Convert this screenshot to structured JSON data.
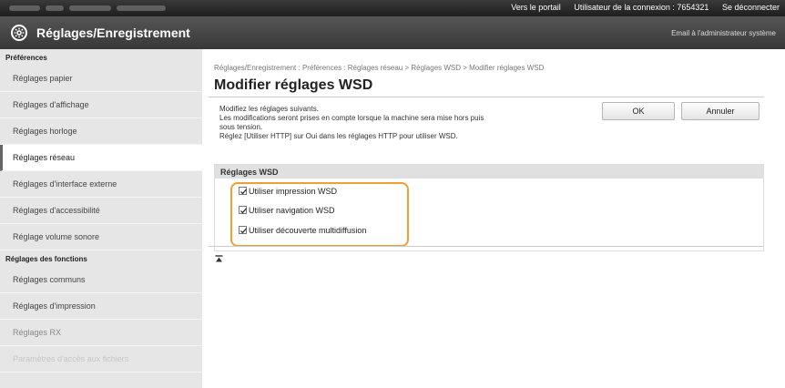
{
  "topbar": {
    "portal_link": "Vers le portail",
    "login_user": "Utilisateur de la connexion : 7654321",
    "logout_link": "Se déconnecter"
  },
  "header": {
    "title": "Réglages/Enregistrement",
    "admin_mail": "Email à l'administrateur système"
  },
  "sidebar": {
    "group_preferences": "Préférences",
    "preferences": [
      "Réglages papier",
      "Réglages d'affichage",
      "Réglages horloge",
      "Réglages réseau",
      "Réglages d'interface externe",
      "Réglages d'accessibilité",
      "Réglage volume sonore"
    ],
    "group_functions": "Réglages des fonctions",
    "functions": [
      "Réglages communs",
      "Réglages d'impression",
      "Réglages RX",
      "Paramètres d'accès aux fichiers"
    ],
    "active_item": "Réglages réseau"
  },
  "main": {
    "breadcrumb": "Réglages/Enregistrement : Préférences : Réglages réseau > Réglages WSD > Modifier réglages WSD",
    "title": "Modifier réglages WSD",
    "desc_line1": "Modifiez les réglages suivants.",
    "desc_line2": "Les modifications seront prises en compte lorsque la machine sera mise hors puis",
    "desc_line3": "sous tension.",
    "desc_line4": "Réglez [Utiliser HTTP] sur Oui dans les réglages HTTP pour utiliser WSD.",
    "ok_label": "OK",
    "cancel_label": "Annuler",
    "section_title": "Réglages WSD",
    "options": [
      {
        "label": "Utiliser impression WSD",
        "checked": true
      },
      {
        "label": "Utiliser navigation WSD",
        "checked": true
      },
      {
        "label": "Utiliser découverte multidiffusion",
        "checked": true
      }
    ]
  },
  "colors": {
    "highlight": "#f0a030",
    "topbar": "#2a2a2a",
    "sidebar": "#e6e6e6"
  }
}
